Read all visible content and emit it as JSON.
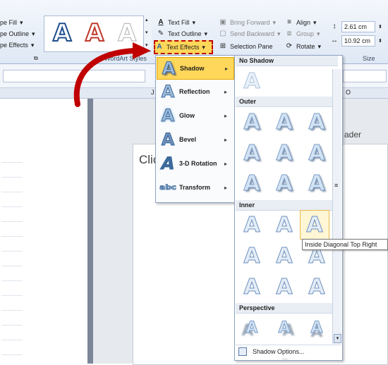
{
  "ribbon": {
    "shape_fill": "pe Fill",
    "shape_outline": "pe Outline",
    "shape_effects": "pe Effects",
    "wordart_group": "WordArt Styles",
    "text_fill": "Text Fill",
    "text_outline": "Text Outline",
    "text_effects": "Text Effects",
    "bring_forward": "Bring Forward",
    "send_backward": "Send Backward",
    "selection_pane": "Selection Pane",
    "align": "Align",
    "group": "Group",
    "rotate": "Rotate",
    "height": "2.61 cm",
    "width": "10.92 cm",
    "size_group": "Size"
  },
  "ruler": {
    "col_j": "J",
    "col_o": "O"
  },
  "document": {
    "placeholder_partial": "Clic",
    "header_partial": "ader"
  },
  "text_effects_menu": {
    "items": [
      {
        "label": "Shadow"
      },
      {
        "label": "Reflection"
      },
      {
        "label": "Glow"
      },
      {
        "label": "Bevel"
      },
      {
        "label": "3-D Rotation"
      },
      {
        "label": "Transform"
      }
    ]
  },
  "shadow_panel": {
    "no_shadow": "No Shadow",
    "outer": "Outer",
    "inner": "Inner",
    "perspective": "Perspective",
    "options": "Shadow Options...",
    "tooltip": "Inside Diagonal Top Right"
  },
  "glyph": "A",
  "colors": {
    "accent_red": "#c00000",
    "highlight": "#ffd75a",
    "menu_border": "#8ea3c1"
  }
}
